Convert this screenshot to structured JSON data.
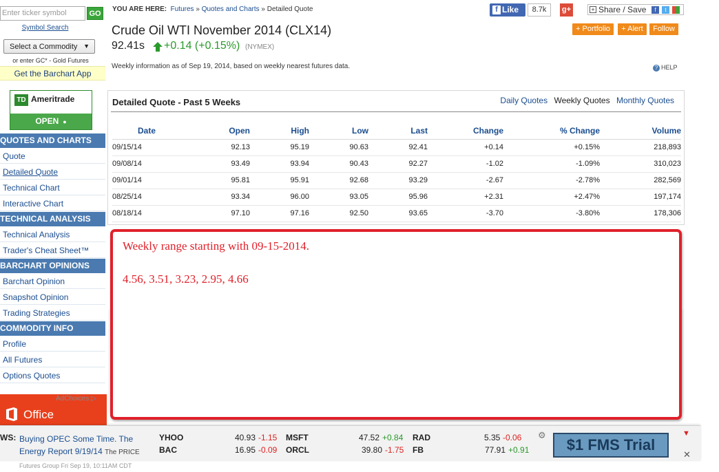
{
  "sidebar": {
    "ticker_placeholder": "Enter ticker symbol",
    "go_label": "GO",
    "symbol_search": "Symbol Search",
    "commodity_select": "Select a Commodity",
    "enter_gc": "or enter GC* - Gold Futures",
    "barchart_app": "Get the Barchart App",
    "td_ad": {
      "name": "Ameritrade",
      "logo": "TD",
      "open": "OPEN"
    },
    "sections": [
      {
        "header": "QUOTES AND CHARTS",
        "items": [
          "Quote",
          "Detailed Quote",
          "Technical Chart",
          "Interactive Chart"
        ]
      },
      {
        "header": "TECHNICAL ANALYSIS",
        "items": [
          "Technical Analysis",
          "Trader's Cheat Sheet™"
        ]
      },
      {
        "header": "BARCHART OPINIONS",
        "items": [
          "Barchart Opinion",
          "Snapshot Opinion",
          "Trading Strategies"
        ]
      },
      {
        "header": "COMMODITY INFO",
        "items": [
          "Profile",
          "All Futures",
          "Options Quotes"
        ]
      }
    ],
    "adchoices": "AdChoices",
    "office_ad": "Office"
  },
  "header": {
    "you_are_here": "YOU ARE HERE:",
    "crumbs": [
      "Futures",
      "Quotes and Charts",
      "Detailed Quote"
    ],
    "fb_like": "Like",
    "fb_count": "8.7k",
    "gplus": "g+",
    "share_save": "Share / Save"
  },
  "quote": {
    "title": "Crude Oil WTI November 2014 (CLX14)",
    "price": "92.41s",
    "change": "+0.14 (+0.15%)",
    "exchange": "(NYMEX)",
    "buttons": [
      "+ Portfolio",
      "+ Alert",
      "Follow"
    ],
    "weekly_info": "Weekly information as of Sep 19, 2014, based on weekly nearest futures data.",
    "help": "HELP"
  },
  "panel": {
    "title": "Detailed Quote - Past 5 Weeks",
    "tabs": [
      "Daily Quotes",
      "Weekly Quotes",
      "Monthly Quotes"
    ],
    "columns": [
      "Date",
      "Open",
      "High",
      "Low",
      "Last",
      "Change",
      "% Change",
      "Volume"
    ],
    "rows": [
      {
        "date": "09/15/14",
        "open": "92.13",
        "high": "95.19",
        "low": "90.63",
        "last": "92.41",
        "change": "+0.14",
        "pct": "+0.15%",
        "volume": "218,893"
      },
      {
        "date": "09/08/14",
        "open": "93.49",
        "high": "93.94",
        "low": "90.43",
        "last": "92.27",
        "change": "-1.02",
        "pct": "-1.09%",
        "volume": "310,023"
      },
      {
        "date": "09/01/14",
        "open": "95.81",
        "high": "95.91",
        "low": "92.68",
        "last": "93.29",
        "change": "-2.67",
        "pct": "-2.78%",
        "volume": "282,569"
      },
      {
        "date": "08/25/14",
        "open": "93.34",
        "high": "96.00",
        "low": "93.05",
        "last": "95.96",
        "change": "+2.31",
        "pct": "+2.47%",
        "volume": "197,174"
      },
      {
        "date": "08/18/14",
        "open": "97.10",
        "high": "97.16",
        "low": "92.50",
        "last": "93.65",
        "change": "-3.70",
        "pct": "-3.80%",
        "volume": "178,306"
      }
    ]
  },
  "overlay": {
    "line1": "Weekly range starting with 09-15-2014.",
    "line2": "4.56,  3.51, 3.23,  2.95,  4.66"
  },
  "ticker_bar": {
    "news_label": "WS:",
    "news_headline": "Buying OPEC Some Time. The Energy Report 9/19/14",
    "news_source": "The PRICE",
    "news_cut": "Futures Group  Fri Sep 19, 10:11AM CDT",
    "quotes": [
      {
        "sym": "YHOO",
        "price": "40.93",
        "chg": "-1.15"
      },
      {
        "sym": "BAC",
        "price": "16.95",
        "chg": "-0.09"
      },
      {
        "sym": "MSFT",
        "price": "47.52",
        "chg": "+0.84"
      },
      {
        "sym": "ORCL",
        "price": "39.80",
        "chg": "-1.75"
      },
      {
        "sym": "RAD",
        "price": "5.35",
        "chg": "-0.06"
      },
      {
        "sym": "FB",
        "price": "77.91",
        "chg": "+0.91"
      }
    ],
    "promo": "$1 FMS Trial"
  },
  "colors": {
    "accent": "#1a4d8f",
    "nav_header": "#4a7ab0",
    "positive": "#2a9a2a",
    "negative": "#dd2222",
    "annotation": "#e0202a",
    "button_orange": "#f08a1a"
  }
}
